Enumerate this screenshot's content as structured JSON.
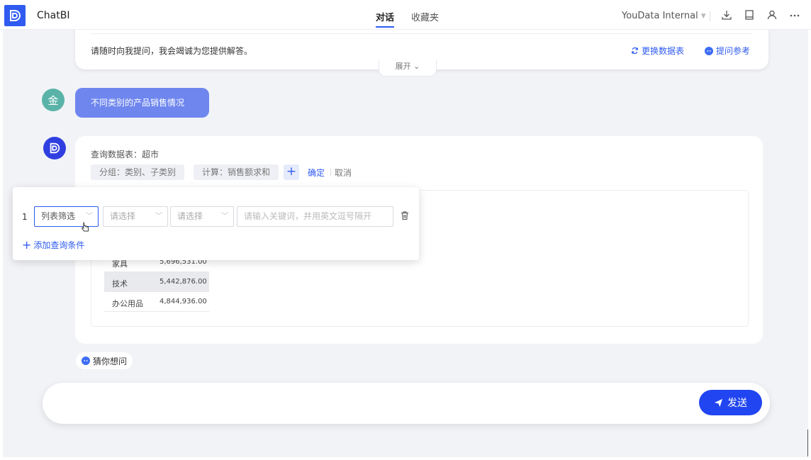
{
  "header": {
    "app_title": "ChatBI",
    "tabs": [
      {
        "label": "对话",
        "active": true
      },
      {
        "label": "收藏夹",
        "active": false
      }
    ],
    "workspace": "YouData Internal",
    "icons": [
      "download-icon",
      "bookmark-icon",
      "user-icon",
      "more-icon"
    ]
  },
  "intro": {
    "text": "请随时向我提问，我会竭诚为您提供解答。",
    "switch_table": "更换数据表",
    "question_ref": "提问参考",
    "expand_label": "展开"
  },
  "user_message": {
    "avatar_text": "金",
    "text": "不同类别的产品销售情况"
  },
  "bot_message": {
    "query_label": "查询数据表：超市",
    "chips": [
      "分组：类别、子类别",
      "计算：销售额求和"
    ],
    "add_label": "+",
    "confirm_label": "确定",
    "cancel_label": "取消",
    "table_rows": [
      {
        "category": "家具",
        "value": "5,696,531.00"
      },
      {
        "category": "技术",
        "value": "5,442,876.00"
      },
      {
        "category": "办公用品",
        "value": "4,844,936.00"
      }
    ]
  },
  "filter": {
    "row_index": "1",
    "field_select": "列表筛选",
    "select_2_placeholder": "请选择",
    "select_3_placeholder": "请选择",
    "keyword_placeholder": "请输入关键词，并用英文逗号隔开",
    "add_condition": "添加查询条件"
  },
  "guess": {
    "label": "猜你想问"
  },
  "composer": {
    "send_label": "发送"
  },
  "colors": {
    "accent": "#2f5bf0",
    "user_bubble": "#6e86ee",
    "send_button": "#2145f0",
    "user_avatar": "#5ab3a8"
  }
}
